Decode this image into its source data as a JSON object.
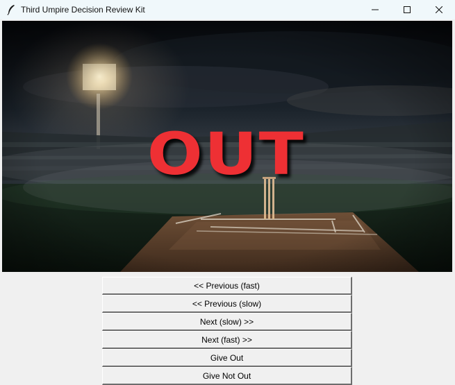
{
  "window": {
    "title": "Third Umpire Decision Review Kit",
    "icon": "feather-icon",
    "controls": [
      "minimize-icon",
      "maximize-icon",
      "close-icon"
    ]
  },
  "display": {
    "decision_text": "OUT",
    "decision_color": "#ee3034",
    "scene": "night cricket stadium with floodlights, stumps and pitch"
  },
  "buttons": {
    "previous_fast": "<< Previous (fast)",
    "previous_slow": "<< Previous (slow)",
    "next_slow": "Next (slow) >>",
    "next_fast": "Next (fast) >>",
    "give_out": "Give Out",
    "give_not_out": "Give Not Out"
  }
}
